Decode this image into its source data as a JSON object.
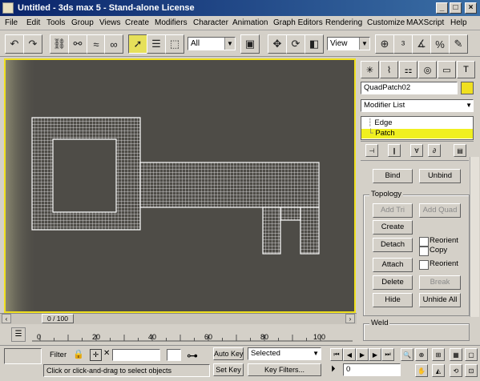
{
  "window": {
    "title": "Untitled - 3ds max 5 - Stand-alone License",
    "min": "_",
    "max": "□",
    "close": "×"
  },
  "menu": [
    "File",
    "Edit",
    "Tools",
    "Group",
    "Views",
    "Create",
    "Modifiers",
    "Character",
    "Animation",
    "Graph Editors",
    "Rendering",
    "Customize",
    "MAXScript",
    "Help"
  ],
  "toolbar": {
    "selection_filter": "All",
    "coord_system": "View"
  },
  "viewport": {
    "frame_counter": "0 / 100"
  },
  "command_panel": {
    "object_name": "QuadPatch02",
    "modifier_list": "Modifier List",
    "stack_items": [
      "Edge",
      "Patch"
    ],
    "buttons": {
      "bind": "Bind",
      "unbind": "Unbind",
      "add_tri": "Add Tri",
      "add_quad": "Add Quad",
      "create": "Create",
      "detach": "Detach",
      "attach": "Attach",
      "delete": "Delete",
      "break": "Break",
      "hide": "Hide",
      "unhide_all": "Unhide All"
    },
    "checkboxes": {
      "reorient": "Reorient",
      "copy": "Copy",
      "reorient2": "Reorient"
    },
    "group_topology": "Topology",
    "group_weld": "Weld"
  },
  "timeline": {
    "ticks": [
      "0",
      "20",
      "40",
      "60",
      "80",
      "100"
    ]
  },
  "status": {
    "filter_label": "Filter",
    "prompt": "Click or click-and-drag to select objects",
    "auto_key": "Auto Key",
    "set_key": "Set Key",
    "selected": "Selected",
    "key_filters": "Key Filters...",
    "frame": "0"
  },
  "colors": {
    "selection_highlight": "#f0e020",
    "viewport_bg": "#4e4c47"
  }
}
